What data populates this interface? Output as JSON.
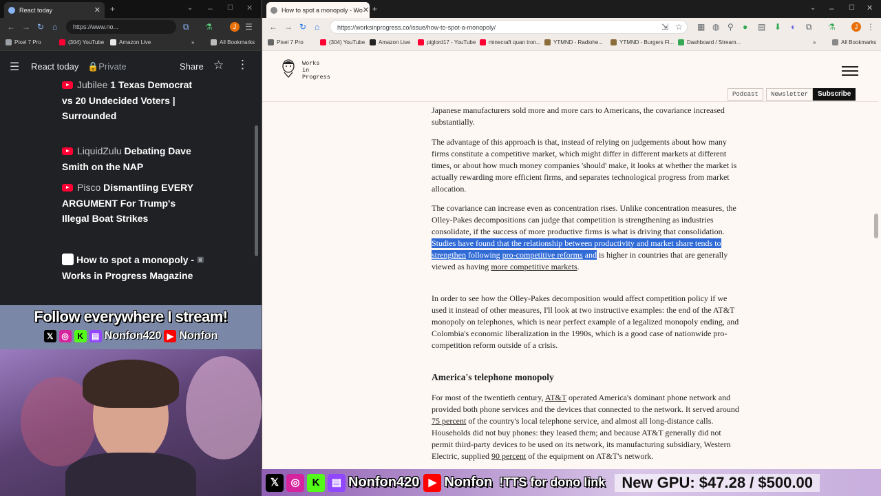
{
  "left_browser": {
    "tab_title": "React today",
    "url": "https://www.no...",
    "bookmarks": [
      "Pixel 7 Pro",
      "(304) YouTube",
      "Amazon Live"
    ],
    "all_bookmarks": "All Bookmarks",
    "sidebar": {
      "title": "React today",
      "private_label": "Private",
      "share_label": "Share"
    },
    "items": [
      {
        "channel": "Jubilee",
        "title": "1 Texas Democrat vs 20 Undecided Voters | Surrounded"
      },
      {
        "channel": "LiquidZulu",
        "title": "Debating Dave Smith on the NAP"
      },
      {
        "channel": "Pisco",
        "title": "Dismantling EVERY ARGUMENT For Trump's Illegal Boat Strikes"
      },
      {
        "channel": "",
        "title": "How to spot a monopoly - Works in Progress Magazine"
      }
    ]
  },
  "overlay": {
    "headline": "Follow everywhere I stream!",
    "handle_1": "Nonfon420",
    "handle_2": "Nonfon"
  },
  "right_browser": {
    "tab_title": "How to spot a monopoly - Wo",
    "url": "https://worksinprogress.co/issue/how-to-spot-a-monopoly/",
    "bookmarks": [
      "Pixel 7 Pro",
      "(304) YouTube",
      "Amazon Live",
      "piglord17 - YouTube",
      "minecraft quan tron...",
      "YTMND - Radiohe...",
      "YTMND - Burgers Fl...",
      "Dashboard / Stream..."
    ],
    "all_bookmarks": "All Bookmarks",
    "site": {
      "logo": "Works\nin\nProgress",
      "podcast": "Podcast",
      "newsletter": "Newsletter",
      "subscribe": "Subscribe"
    },
    "article": {
      "p0_top": "...",
      "p0": "Japanese manufacturers sold more and more cars to Americans, the covariance increased substantially.",
      "p1": "The advantage of this approach is that, instead of relying on judgements about how many firms constitute a competitive market, which might differ in different markets at different times, or about how much money companies 'should' make, it looks at whether the market is actually rewarding more efficient firms, and separates technological progress from market allocation.",
      "p2_a": "The covariance can increase even as concentration rises. Unlike concentration measures, the Olley-Pakes decompositions can judge that competition is strengthening as industries consolidate, if the success of more productive firms is what is driving that consolidation. ",
      "p2_hl_a": "Studies have found that the relationship between productivity and market share tends to ",
      "p2_link1": "strengthen",
      "p2_hl_b": " following ",
      "p2_link2": "pro-competitive reforms",
      "p2_hl_c": " and",
      "p2_b": " is higher in countries that are generally viewed as having ",
      "p2_link3": "more competitive markets",
      "p2_end": ".",
      "p3": "In order to see how the Olley-Pakes decomposition would affect competition policy if we used it instead of other measures, I'll look at two instructive examples: the end of the AT&T monopoly on telephones, which is near perfect example of a legalized monopoly ending, and Colombia's economic liberalization in the 1990s, which is a good case of nationwide pro-competition reform outside of a crisis.",
      "h2": "America's telephone monopoly",
      "p4_a": "For most of the twentieth century, ",
      "p4_link1": "AT&T",
      "p4_b": " operated America's dominant phone network and provided both phone services and the devices that connected to the network. It served around ",
      "p4_link2": "75 percent",
      "p4_c": " of the country's local telephone service, and almost all long-distance calls. Households did not buy phones: they leased them; and because AT&T generally did not permit third-party devices to be used on its network, its manufacturing subsidiary, Western Electric, supplied ",
      "p4_link3": "90 percent",
      "p4_d": " of the equipment on AT&T's network."
    }
  },
  "ticker": {
    "handle_1": "Nonfon420",
    "handle_2": "Nonfon",
    "tts": "!TTS for dono link",
    "goal": "New GPU: $47.28 / $500.00"
  }
}
